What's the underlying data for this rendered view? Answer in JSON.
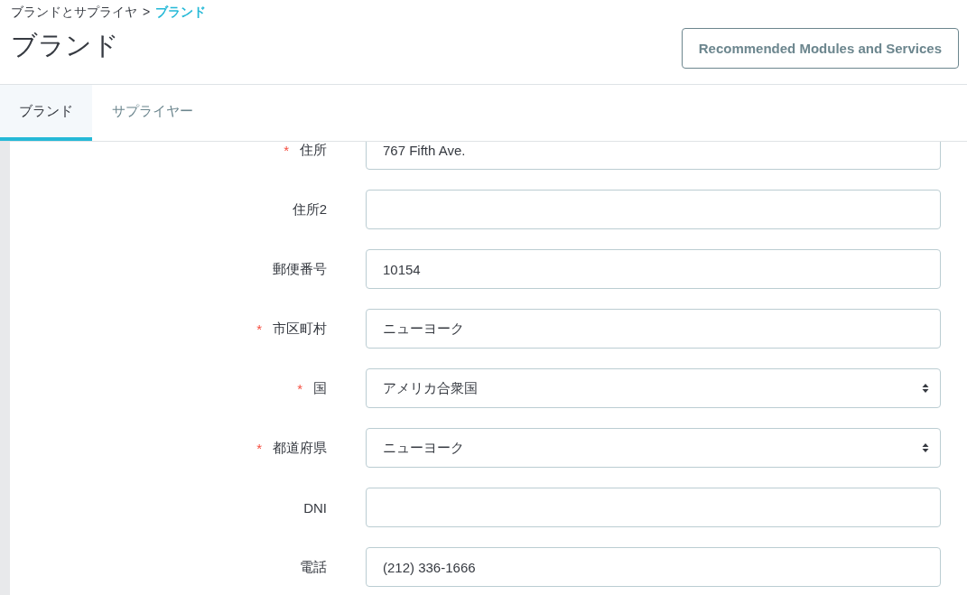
{
  "breadcrumb": {
    "parent": "ブランドとサプライヤ",
    "separator": ">",
    "current": "ブランド"
  },
  "page_title": "ブランド",
  "header_button": "Recommended Modules and Services",
  "tabs": [
    {
      "label": "ブランド",
      "selected": true
    },
    {
      "label": "サプライヤー",
      "selected": false
    }
  ],
  "fields": [
    {
      "label": "住所",
      "required_mark": "*",
      "kind": "text",
      "value": "767 Fifth Ave."
    },
    {
      "label": "住所2",
      "kind": "text"
    },
    {
      "label": "郵便番号",
      "kind": "text",
      "value": "10154"
    },
    {
      "label": "市区町村",
      "required_mark": "*",
      "kind": "text",
      "value": "ニューヨーク"
    },
    {
      "label": "国",
      "required_mark": "*",
      "kind": "select",
      "value": "アメリカ合衆国"
    },
    {
      "label": "都道府県",
      "required_mark": "*",
      "kind": "select",
      "value": "ニューヨーク"
    },
    {
      "label": "DNI",
      "kind": "text"
    },
    {
      "label": "電話",
      "kind": "text",
      "value": "(212) 336-1666"
    }
  ]
}
